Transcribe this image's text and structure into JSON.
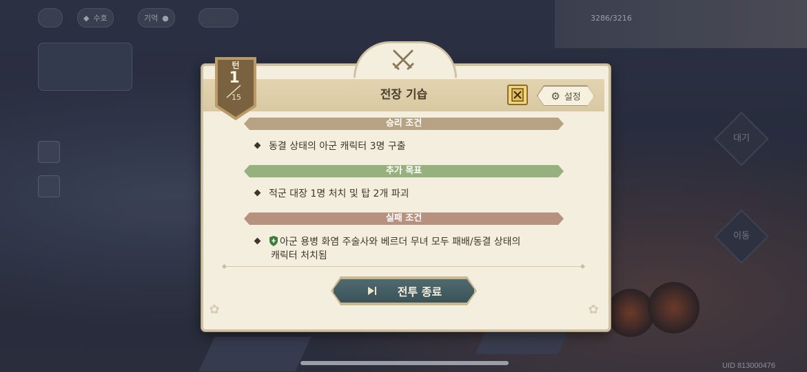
{
  "hud": {
    "chip1": "수호",
    "chip2": "기억",
    "topright_stat": "3286/3216"
  },
  "background": {
    "diamond_top_label": "대기",
    "diamond_bottom_label": "이동"
  },
  "modal": {
    "title": "전장 기습",
    "turn": {
      "label": "턴",
      "current": "1",
      "total": "15"
    },
    "settings_label": "설정",
    "sections": {
      "victory": {
        "title": "승리 조건",
        "item": "동결 상태의 아군 캐릭터 3명 구출"
      },
      "bonus": {
        "title": "추가 목표",
        "item": "적군 대장 1명 처치 및 탑 2개 파괴"
      },
      "defeat": {
        "title": "실패 조건",
        "item_line1": "아군 용병 화염 주술사와 베르더 무녀 모두 패배/동결 상태의",
        "item_line2": "캐릭터 처치됨"
      }
    },
    "end_button": "전투 종료"
  },
  "uid": "UID 813000476",
  "colors": {
    "victory_bar": "#b7a283",
    "bonus_bar": "#96b17d",
    "defeat_bar": "#b69180",
    "end_button": "#4a6268",
    "turn_banner": "#7a6240"
  },
  "icons": [
    "crossed-swords-icon",
    "book-icon",
    "gear-icon",
    "shield-icon",
    "play-arrow-icon"
  ]
}
